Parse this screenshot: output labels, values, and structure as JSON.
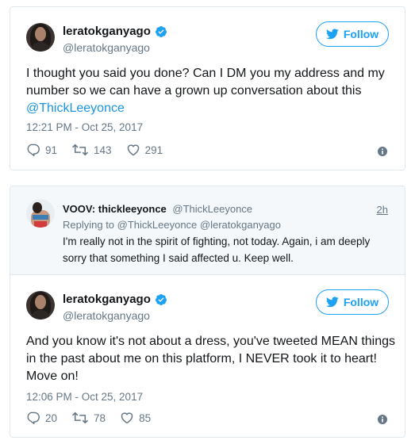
{
  "colors": {
    "accent": "#1da1f2",
    "muted": "#657786",
    "border": "#e1e8ed",
    "reply_bg": "#f5f8fa"
  },
  "tweet1": {
    "display_name": "leratokganyago",
    "handle": "@leratokganyago",
    "follow_label": "Follow",
    "text": "I thought you said you done? Can I DM you my address and my number so we can have a grown up conversation about this",
    "mention": "@ThickLeeyonce",
    "timestamp": "12:21 PM - Oct 25, 2017",
    "replies": "91",
    "retweets": "143",
    "likes": "291",
    "icons": [
      "verified-icon",
      "twitter-bird-icon",
      "reply-icon",
      "retweet-icon",
      "like-icon",
      "info-icon"
    ]
  },
  "quoted_reply": {
    "display_name": "VOOV: thickleeyonce",
    "handle": "@ThickLeeyonce",
    "time": "2h",
    "replying_to": "Replying to @ThickLeeyonce @leratokganyago",
    "text": "I'm really not in the spirit of fighting, not today. Again, i am deeply sorry that something I said affected u. Keep well."
  },
  "tweet2": {
    "display_name": "leratokganyago",
    "handle": "@leratokganyago",
    "follow_label": "Follow",
    "text": "And you know it's not about a dress, you've tweeted MEAN things in the past about me on this platform, I NEVER took it to heart! Move on!",
    "timestamp": "12:06 PM - Oct 25, 2017",
    "replies": "20",
    "retweets": "78",
    "likes": "85"
  }
}
